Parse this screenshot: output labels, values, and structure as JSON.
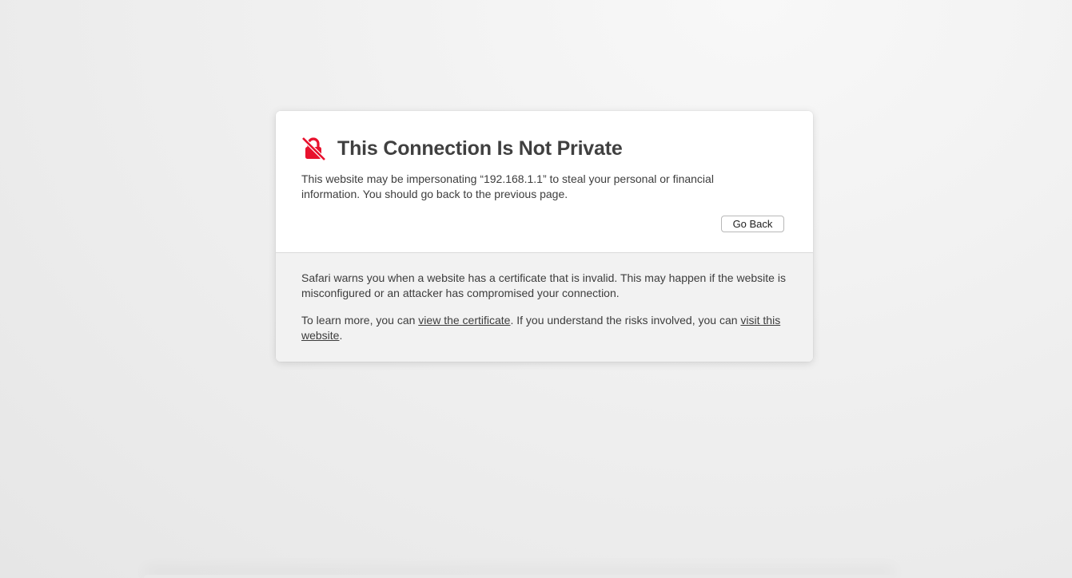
{
  "dialog": {
    "title": "This Connection Is Not Private",
    "icon": "lock-slash-icon",
    "accent_color": "#e8112d",
    "description": "This website may be impersonating “192.168.1.1” to steal your personal or financial information. You should go back to the previous page.",
    "go_back_label": "Go Back",
    "details": {
      "warning_text": "Safari warns you when a website has a certificate that is invalid. This may happen if the website is misconfigured or an attacker has compromised your connection.",
      "learn_prefix": "To learn more, you can ",
      "view_certificate_link": "view the certificate",
      "learn_middle": ". If you understand the risks involved, you can ",
      "visit_website_link": "visit this website",
      "learn_suffix": "."
    }
  }
}
